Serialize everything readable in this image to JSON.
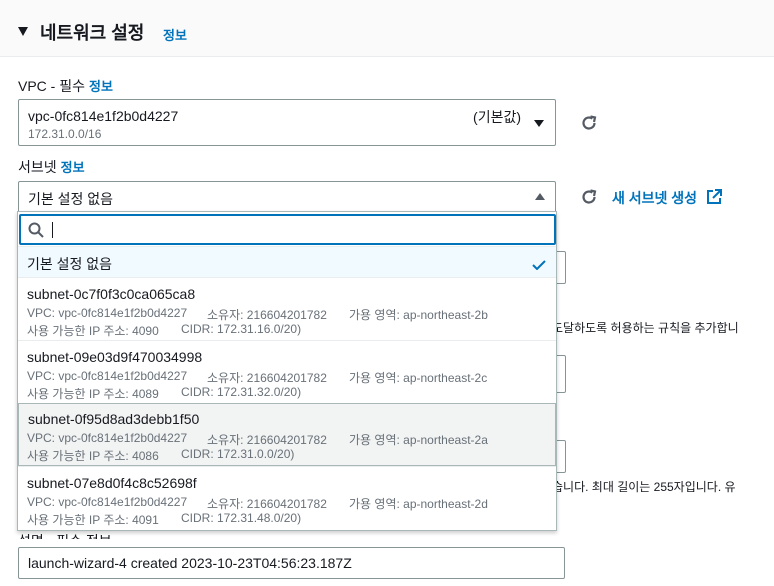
{
  "section": {
    "title": "네트워크 설정",
    "info": "정보"
  },
  "vpc": {
    "label": "VPC - 필수",
    "info": "정보",
    "value": "vpc-0fc814e1f2b0d4227",
    "cidr": "172.31.0.0/16",
    "tag": "(기본값)"
  },
  "subnet": {
    "label": "서브넷",
    "info": "정보",
    "value": "기본 설정 없음",
    "new_link": "새 서브넷 생성",
    "search_placeholder": "",
    "options": [
      {
        "name": "기본 설정 없음",
        "selected": true
      },
      {
        "name": "subnet-0c7f0f3c0ca065ca8",
        "vpc": "VPC: vpc-0fc814e1f2b0d4227",
        "owner": "소유자: 216604201782",
        "az": "가용 영역: ap-northeast-2b",
        "ips": "사용 가능한 IP 주소: 4090",
        "cidr": "CIDR: 172.31.16.0/20)"
      },
      {
        "name": "subnet-09e03d9f470034998",
        "vpc": "VPC: vpc-0fc814e1f2b0d4227",
        "owner": "소유자: 216604201782",
        "az": "가용 영역: ap-northeast-2c",
        "ips": "사용 가능한 IP 주소: 4089",
        "cidr": "CIDR: 172.31.32.0/20)"
      },
      {
        "name": "subnet-0f95d8ad3debb1f50",
        "vpc": "VPC: vpc-0fc814e1f2b0d4227",
        "owner": "소유자: 216604201782",
        "az": "가용 영역: ap-northeast-2a",
        "ips": "사용 가능한 IP 주소: 4086",
        "cidr": "CIDR: 172.31.0.0/20)"
      },
      {
        "name": "subnet-07e8d0f4c8c52698f",
        "vpc": "VPC: vpc-0fc814e1f2b0d4227",
        "owner": "소유자: 216604201782",
        "az": "가용 영역: ap-northeast-2d",
        "ips": "사용 가능한 IP 주소: 4091",
        "cidr": "CIDR: 172.31.48.0/20)"
      }
    ]
  },
  "background": {
    "rule_text": "도달하도록 허용하는 규칙을 추가합니",
    "length_text": "습니다. 최대 길이는 255자입니다. 유"
  },
  "description": {
    "label": "설명 - 필수 정보",
    "value": "launch-wizard-4 created 2023-10-23T04:56:23.187Z"
  },
  "colors": {
    "link": "#0073bb",
    "border": "#879596",
    "text": "#16191f",
    "muted": "#687078"
  }
}
